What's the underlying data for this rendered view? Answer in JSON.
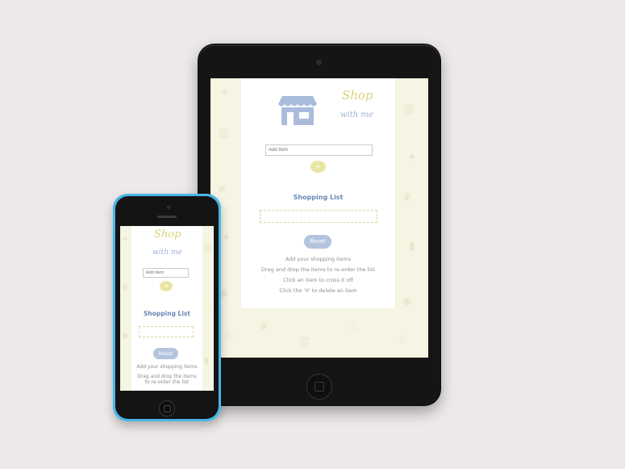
{
  "app": {
    "title_line1": "Shop",
    "title_line2": "with me"
  },
  "form": {
    "add_placeholder": "Add Item",
    "add_button": "+"
  },
  "list": {
    "heading": "Shopping List"
  },
  "reset_button": "Reset",
  "instructions": [
    "Add your shopping items",
    "Drag and drop the items to re-order the list",
    "Click an item to cross it off",
    "Click the 'X' to delete an item"
  ],
  "colors": {
    "background": "#ede9e9",
    "screen_bg": "#f6f4e2",
    "title_yellow": "#d9d27a",
    "title_blue": "#9fb2d4",
    "heading_blue": "#6a88b5",
    "store_icon": "#a9bcdc",
    "reset_button": "#b4c4df",
    "phone_shell": "#49b6e8",
    "tablet_shell": "#151515"
  },
  "icons": [
    "store-icon",
    "pineapple-icon",
    "cherry-icon",
    "cake-icon",
    "bread-icon",
    "lemon-icon",
    "milk-icon"
  ]
}
